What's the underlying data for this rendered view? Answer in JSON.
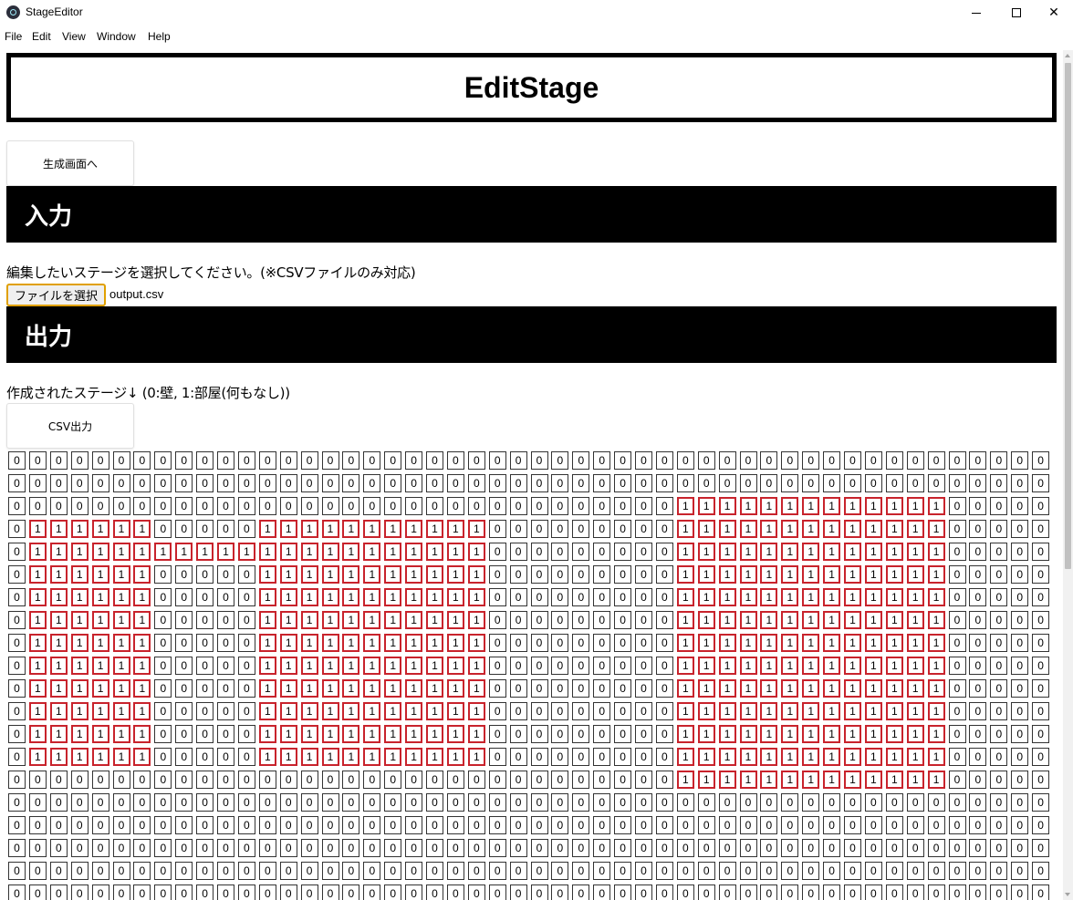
{
  "window": {
    "title": "StageEditor",
    "menu": [
      "File",
      "Edit",
      "View",
      "Window",
      "Help"
    ]
  },
  "page": {
    "title": "EditStage",
    "generate_button": "生成画面へ",
    "input_section": "入力",
    "input_description": "編集したいステージを選択してください。(※CSVファイルのみ対応)",
    "file_button": "ファイルを選択",
    "file_name": "output.csv",
    "output_section": "出力",
    "output_description": "作成されたステージ↓ (0:壁, 1:部屋(何もなし))",
    "csv_button": "CSV出力"
  },
  "colors": {
    "room_border": "#c8232c",
    "wall_border": "#333333",
    "file_button_focus": "#e0a000"
  },
  "stage_rows": [
    "00000000000000000000000000000000000000000000000000",
    "00000000000000000000000000000000000000000000000000",
    "00000000000000000000000000000000111111111111100000",
    "01111110000011111111111000000000111111111111100000",
    "01111111111111111111111000000000111111111111100000",
    "01111110000011111111111000000000111111111111100000",
    "01111110000011111111111000000000111111111111100000",
    "01111110000011111111111000000000111111111111100000",
    "01111110000011111111111000000000111111111111100000",
    "01111110000011111111111000000000111111111111100000",
    "01111110000011111111111000000000111111111111100000",
    "01111110000011111111111000000000111111111111100000",
    "01111110000011111111111000000000111111111111100000",
    "01111110000011111111111000000000111111111111100000",
    "00000000000000000000000000000000111111111111100000",
    "00000000000000000000000000000000000000000000000000",
    "00000000000000000000000000000000000000000000000000",
    "00000000000000000000000000000000000000000000000000",
    "00000000000000000000000000000000000000000000000000",
    "00000000000000000000000000000000000000000000000000"
  ]
}
